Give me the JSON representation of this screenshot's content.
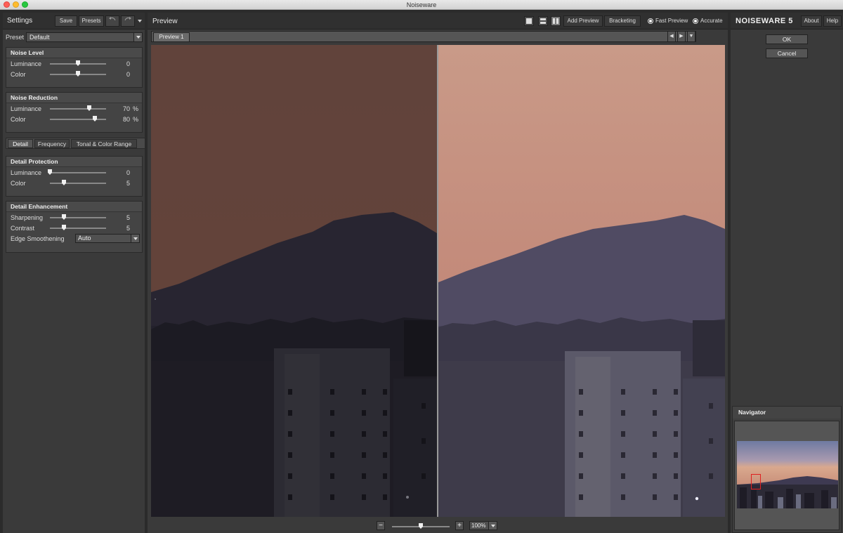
{
  "window": {
    "title": "Noiseware"
  },
  "left": {
    "title": "Settings",
    "save_label": "Save",
    "presets_label": "Presets",
    "preset_label": "Preset",
    "preset_value": "Default",
    "noise_level": {
      "title": "Noise Level",
      "rows": [
        {
          "label": "Luminance",
          "value": "0",
          "unit": "",
          "level": 0.5
        },
        {
          "label": "Color",
          "value": "0",
          "unit": "",
          "level": 0.5
        }
      ]
    },
    "noise_reduction": {
      "title": "Noise Reduction",
      "rows": [
        {
          "label": "Luminance",
          "value": "70",
          "unit": "%",
          "level": 0.7
        },
        {
          "label": "Color",
          "value": "80",
          "unit": "%",
          "level": 0.8
        }
      ]
    },
    "tabs": [
      "Detail",
      "Frequency",
      "Tonal & Color Range"
    ],
    "detail_protection": {
      "title": "Detail Protection",
      "rows": [
        {
          "label": "Luminance",
          "value": "0",
          "unit": "",
          "level": 0.0
        },
        {
          "label": "Color",
          "value": "5",
          "unit": "",
          "level": 0.25
        }
      ]
    },
    "detail_enhancement": {
      "title": "Detail Enhancement",
      "rows": [
        {
          "label": "Sharpening",
          "value": "5",
          "unit": "",
          "level": 0.25
        },
        {
          "label": "Contrast",
          "value": "5",
          "unit": "",
          "level": 0.25
        }
      ],
      "edge_label": "Edge Smoothening",
      "edge_value": "Auto"
    }
  },
  "center": {
    "title": "Preview",
    "add_preview": "Add Preview",
    "bracketing": "Bracketing",
    "fast_preview": "Fast Preview",
    "accurate": "Accurate",
    "preview_tab": "Preview 1",
    "zoom_minus": "−",
    "zoom_plus": "+",
    "zoom_value": "100%",
    "zoom_level": 0.5
  },
  "right": {
    "brand": "NOISEWARE 5",
    "about": "About",
    "help": "Help",
    "ok": "OK",
    "cancel": "Cancel",
    "navigator": "Navigator"
  },
  "colors": {
    "sky_top_before": "#c48878",
    "sky_top_after": "#c99a88",
    "mountain": "#4f4b62",
    "buildings": "#3e3b4a",
    "navigator_box": "#e02020"
  }
}
